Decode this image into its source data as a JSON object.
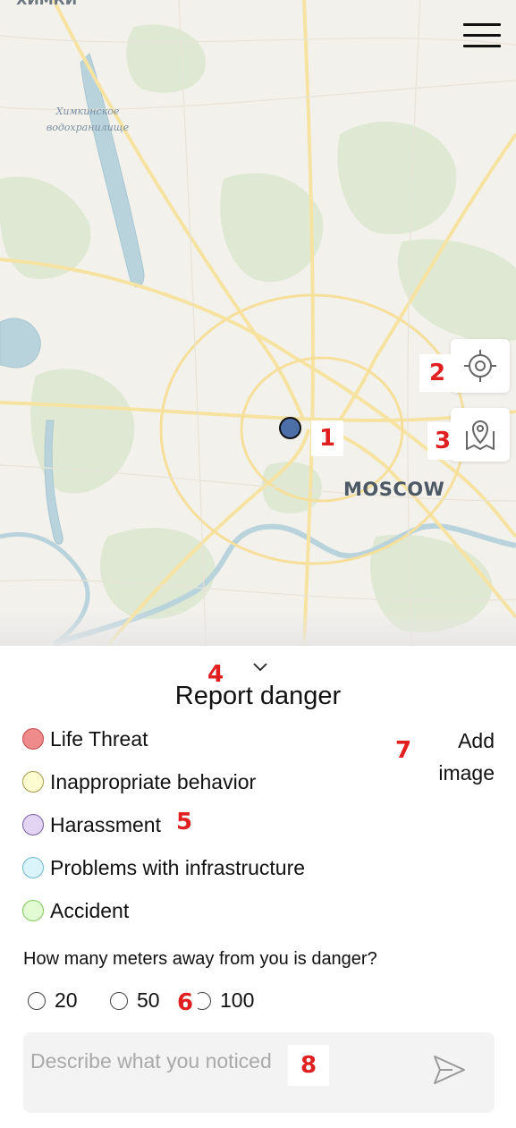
{
  "map": {
    "top_label": "ХИМКИ",
    "reservoir_label": "Химкинское водохранилище",
    "city_label": "MOSCOW",
    "icons": {
      "menu": "hamburger-menu-icon",
      "locate": "crosshair-locate-icon",
      "pin": "map-pin-icon",
      "user": "user-location-marker"
    }
  },
  "annotations": [
    "1",
    "2",
    "3",
    "4",
    "5",
    "6",
    "7",
    "8"
  ],
  "sheet": {
    "title": "Report danger",
    "categories": [
      {
        "label": "Life Threat",
        "color": "#f08b8b"
      },
      {
        "label": "Inappropriate behavior",
        "color": "#fdfbd0"
      },
      {
        "label": "Harassment",
        "color": "#e2d4f2"
      },
      {
        "label": "Problems with infrastructure",
        "color": "#d9f5fb"
      },
      {
        "label": "Accident",
        "color": "#e2fbd3"
      }
    ],
    "add_image_label": "Add image",
    "distance_question": "How many meters away from you is danger?",
    "distance_options": [
      "20",
      "50",
      "100"
    ],
    "description": {
      "placeholder": "Describe what you noticed",
      "value": ""
    }
  },
  "colors": {
    "accent_red": "#e02020",
    "user_marker": "#4d6fa8"
  }
}
